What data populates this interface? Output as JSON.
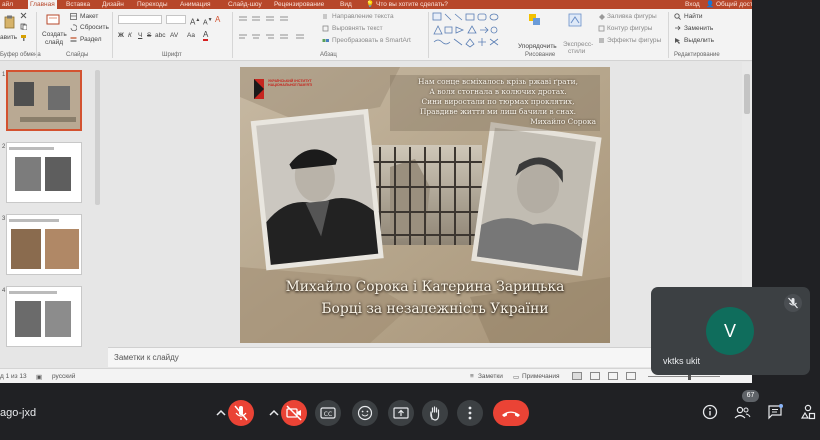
{
  "ribbon": {
    "tabs": [
      "айл",
      "Главная",
      "Вставка",
      "Дизайн",
      "Переходы",
      "Анимация",
      "Слайд-шоу",
      "Рецензирование",
      "Вид"
    ],
    "tell_me": "Что вы хотите сделать?",
    "sign_in": "Вход",
    "share": "Общий доступ",
    "clipboard": {
      "paste": "авить",
      "label": "Буфер обмена"
    },
    "slides": {
      "create": "Создать",
      "create2": "слайд",
      "layout": "Макет",
      "reset": "Сбросить",
      "section": "Раздел",
      "label": "Слайды"
    },
    "font": {
      "bold": "Ж",
      "italic": "К",
      "underline": "Ч",
      "strike": "S",
      "shadow": "abc",
      "spacing": "AV",
      "case": "Aa",
      "label": "Шрифт"
    },
    "paragraph": {
      "direction": "Направление текста",
      "align": "Выровнять текст",
      "smartart": "Преобразовать в SmartArt",
      "label": "Абзац"
    },
    "drawing": {
      "arrange": "Упорядочить",
      "quick": "Экспресс-",
      "quick2": "стили",
      "fill": "Заливка фигуры",
      "outline": "Контур фигуры",
      "effects": "Эффекты фигуры",
      "label": "Рисование"
    },
    "editing": {
      "find": "Найти",
      "replace": "Заменить",
      "select": "Выделить",
      "label": "Редактирование"
    }
  },
  "slide": {
    "logo_text": "УКРАЇНСЬКИЙ ІНСТИТУТ НАЦІОНАЛЬНОЇ ПАМ'ЯТІ",
    "poem": [
      "Нам сонце всміхалось крізь ржаві ґрати,",
      "А воля стогнала в колючих дротах.",
      "Сини виростали по тюрмах проклятих,",
      "Правдиве життя ми лиш бачили в снах."
    ],
    "poem_author": "Михайло Сорока",
    "title_line1": "Михайло Сорока і Катерина Зарицька",
    "title_line2": "Борці за незалежність України"
  },
  "thumbnails": [
    {
      "num": "1",
      "caption": "Михайло Сорока і Катерина Зарицька Борці за незалежність України"
    },
    {
      "num": "2",
      "caption": "Михайло Сорока і Катерина Зарицька"
    },
    {
      "num": "3",
      "caption": "За Україну життя проклали ОУН"
    },
    {
      "num": "4",
      "caption": "Нагородження відзнакою УПА"
    }
  ],
  "notes_placeholder": "Заметки к слайду",
  "status": {
    "slide_of": "д 1 из 13",
    "language": "русский",
    "notes": "Заметки",
    "comments": "Примечания"
  },
  "participant": {
    "initial": "V",
    "name": "vktks ukit"
  },
  "meet": {
    "meeting_code": "ago-jxd",
    "people_count": "67"
  },
  "colors": {
    "ppt_accent": "#b7472a",
    "end_call": "#ea4335",
    "avatar_bg": "#0f6d5c"
  }
}
